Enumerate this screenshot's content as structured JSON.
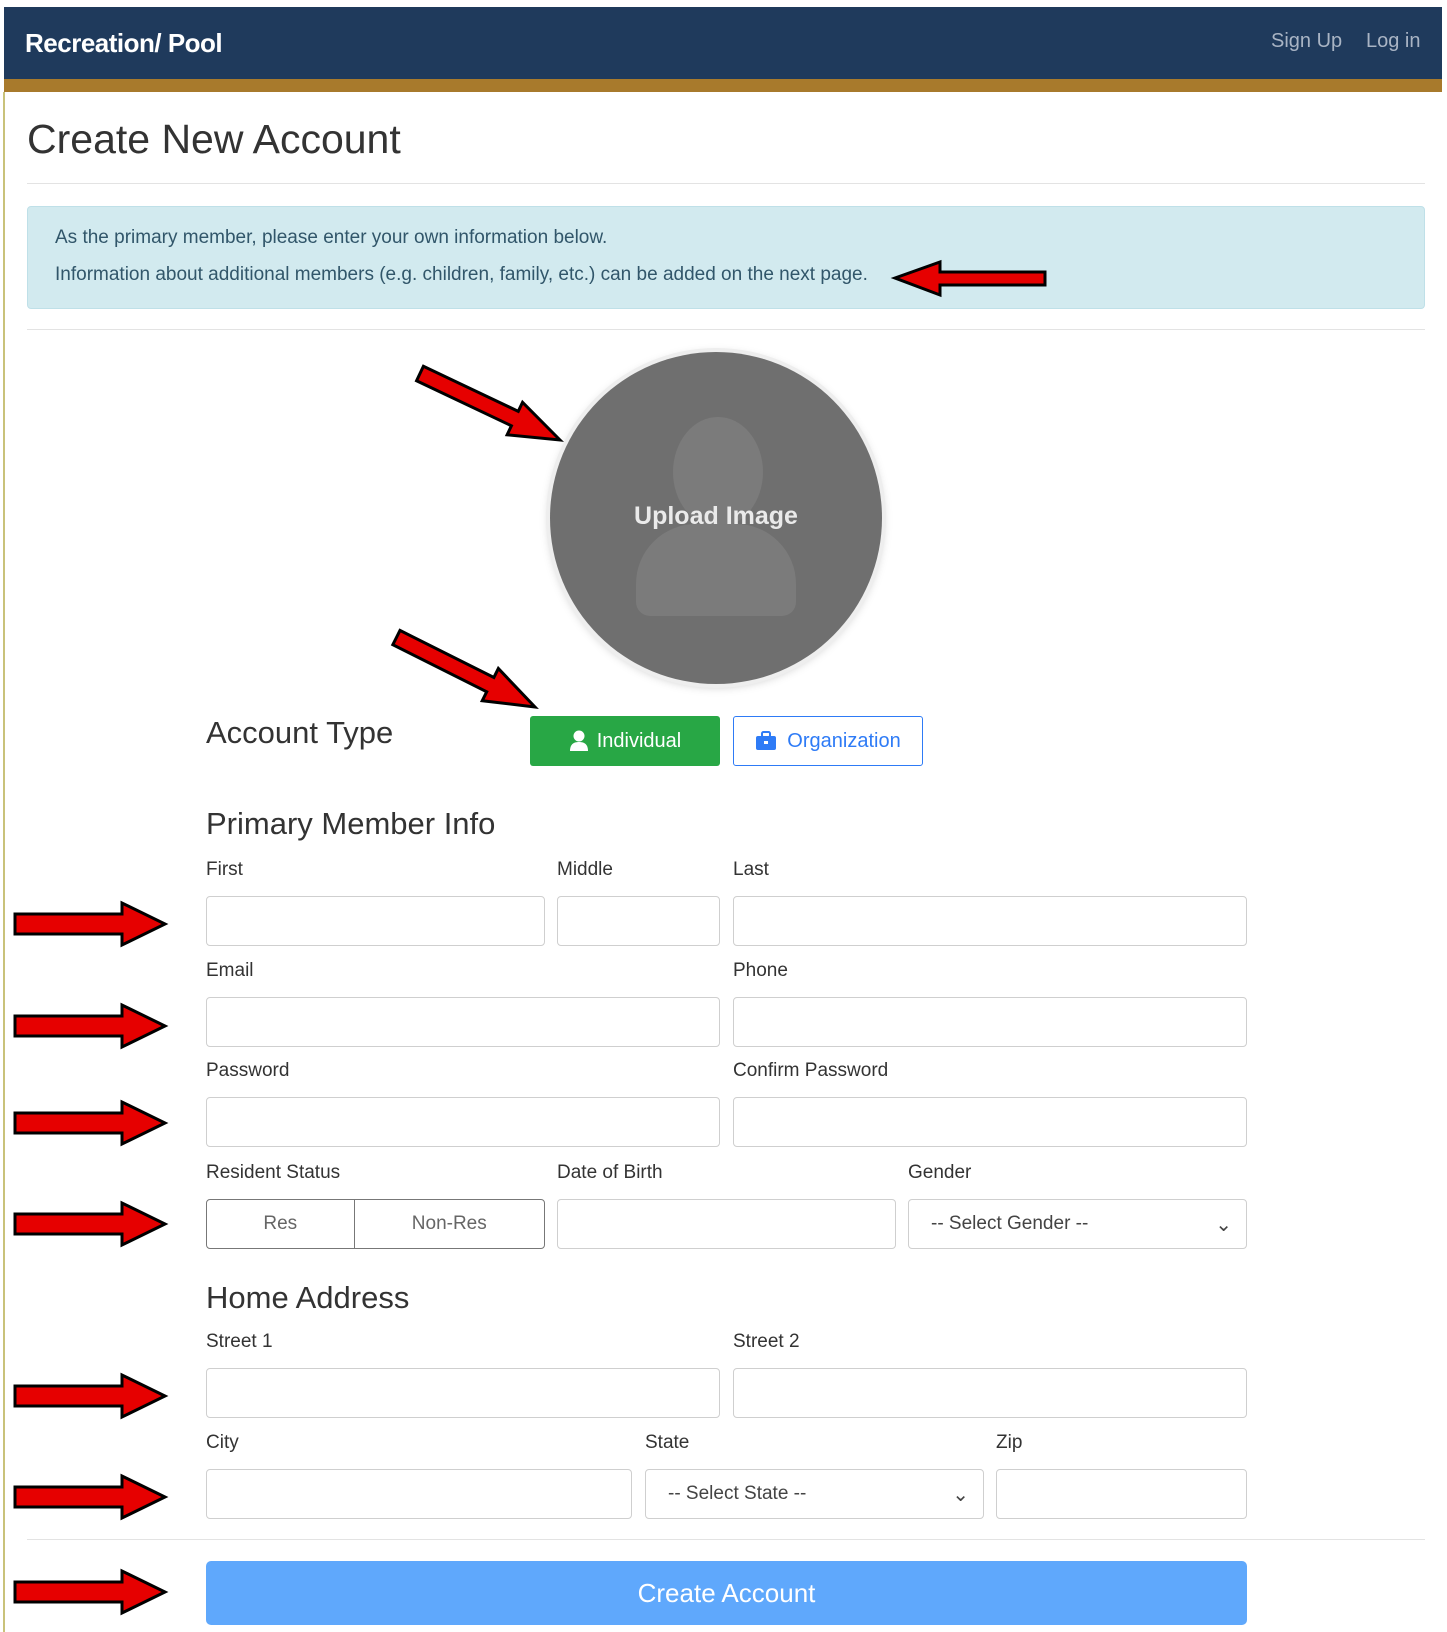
{
  "navbar": {
    "brand": "Recreation/ Pool",
    "signup": "Sign Up",
    "login": "Log in"
  },
  "page_title": "Create New Account",
  "alert": {
    "line1": "As the primary member, please enter your own information below.",
    "line2": "Information about additional members (e.g. children, family, etc.) can be added on the next page."
  },
  "avatar": {
    "upload_label": "Upload Image"
  },
  "account_type": {
    "label": "Account Type",
    "individual": "Individual",
    "organization": "Organization"
  },
  "primary_member": {
    "title": "Primary Member Info",
    "first": "First",
    "middle": "Middle",
    "last": "Last",
    "email": "Email",
    "phone": "Phone",
    "password": "Password",
    "confirm_password": "Confirm Password",
    "resident_status": "Resident Status",
    "res": "Res",
    "non_res": "Non-Res",
    "dob": "Date of Birth",
    "gender": "Gender",
    "gender_placeholder": "-- Select Gender --"
  },
  "home_address": {
    "title": "Home Address",
    "street1": "Street 1",
    "street2": "Street 2",
    "city": "City",
    "state": "State",
    "state_placeholder": "-- Select State --",
    "zip": "Zip"
  },
  "submit_label": "Create Account",
  "colors": {
    "navbar": "#1f3a5c",
    "accent_bar": "#a87a2c",
    "individual_button": "#28a745",
    "organization_button": "#2e7bf6",
    "submit_button": "#5fa8fc",
    "annotation_arrow": "#e60000"
  }
}
